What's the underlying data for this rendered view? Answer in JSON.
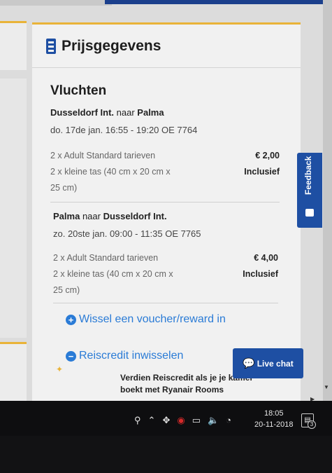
{
  "card": {
    "title": "Prijsgegevens",
    "section_title": "Vluchten"
  },
  "flight1": {
    "origin": "Dusseldorf Int.",
    "connector": "naar",
    "destination": "Palma",
    "datetime": "do. 17de jan. 16:55 - 19:20 OE 7764",
    "fare_label": "2 x Adult Standard tarieven",
    "fare_price": "€ 2,00",
    "bag_label_line1": "2 x kleine tas (40 cm x 20 cm x",
    "bag_label_line2": "25 cm)",
    "bag_price": "Inclusief"
  },
  "flight2": {
    "origin": "Palma",
    "connector": "naar",
    "destination": "Dusseldorf Int.",
    "datetime": "zo. 20ste jan. 09:00 - 11:35 OE 7765",
    "fare_label": "2 x Adult Standard tarieven",
    "fare_price": "€ 4,00",
    "bag_label_line1": "2 x kleine tas (40 cm x 20 cm x",
    "bag_label_line2": "25 cm)",
    "bag_price": "Inclusief"
  },
  "links": {
    "voucher": "Wissel een voucher/reward in",
    "voucher_icon": "plus",
    "reiscredit": "Reiscredit inwisselen",
    "reiscredit_icon": "minus"
  },
  "reward": {
    "line1": "Verdien Reiscredit als je je kamer",
    "line2": "boekt met Ryanair Rooms"
  },
  "feedback": {
    "label": "Feedback"
  },
  "live_chat": {
    "label": "Live chat"
  },
  "taskbar": {
    "time": "18:05",
    "date": "20-11-2018",
    "notifications": "3"
  },
  "colors": {
    "accent_blue": "#1e4fa3",
    "link_blue": "#2a7bd6",
    "card_top_border": "#e9b338"
  }
}
